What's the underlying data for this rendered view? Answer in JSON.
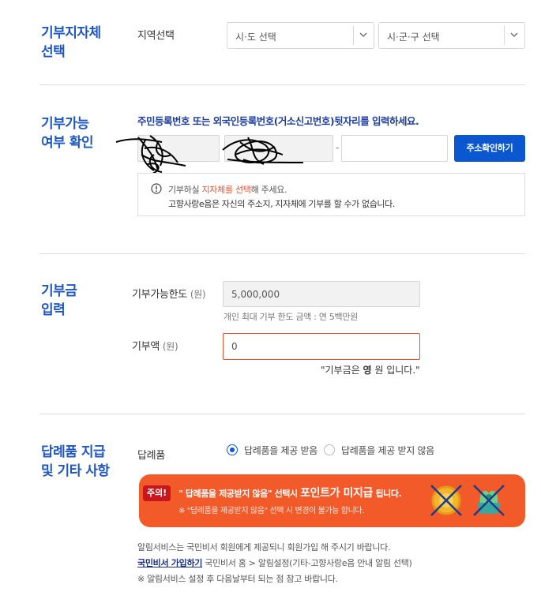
{
  "section1": {
    "title_line1": "기부지자체",
    "title_line2": "선택",
    "region_label": "지역선택",
    "sido_select": "시·도 선택",
    "sigungu_select": "시·군·구 선택"
  },
  "section2": {
    "title_line1": "기부가능",
    "title_line2": "여부 확인",
    "instruction": "주민등록번호 또는 외국인등록번호(거소신고번호)뒷자리를 입력하세요.",
    "dash": "-",
    "address_button": "주소확인하기",
    "notice_prefix": "기부하실 ",
    "notice_highlight": "지자체를 선택",
    "notice_suffix": "해 주세요.",
    "notice_line2": "고향사랑e음은 자신의 주소지, 지자체에 기부를 할 수가 없습니다."
  },
  "section3": {
    "title_line1": "기부금",
    "title_line2": "입력",
    "limit_label": "기부가능한도",
    "unit": "(원)",
    "limit_value": "5,000,000",
    "limit_help": "개인 최대 기부 한도 금액 : 연 5백만원",
    "amount_label": "기부액",
    "amount_value": "0",
    "amount_msg_prefix": "\"기부금은 ",
    "amount_msg_bold": "영",
    "amount_msg_suffix": " 원 입니다.\""
  },
  "section4": {
    "title_line1": "답례품 지급",
    "title_line2": "및 기타 사항",
    "gift_label": "답례품",
    "radio_receive": "답례품을 제공 받음",
    "radio_decline": "답례품을 제공 받지 않음",
    "banner_badge": "주의!",
    "banner_text1": "\" 답례품을 제공받지 않음\" 선택시 ",
    "banner_text_big": "포인트가 미지급",
    "banner_text2": " 됩니다.",
    "banner_sub": "※ \"답례품을 제공받지 않음\" 선택 시 변경이 불가능 합니다.",
    "info_line1": "알림서비스는 국민비서 회원에게 제공되니 회원가입 해 주시기 바랍니다.",
    "info_link": "국민비서 가입하기",
    "info_line2_rest": " 국민비서 홈 > 알림설정(기타-고향사랑e음 안내 알림 선택)",
    "info_line3": "※ 알림서비스 설정 후 다음날부터 되는 점 참고 바랍니다."
  },
  "colors": {
    "accent_blue": "#1f57c3",
    "button_blue": "#0b57d0",
    "banner_orange": "#f25a2a",
    "badge_red": "#c9161e",
    "error_red": "#e8502f"
  }
}
